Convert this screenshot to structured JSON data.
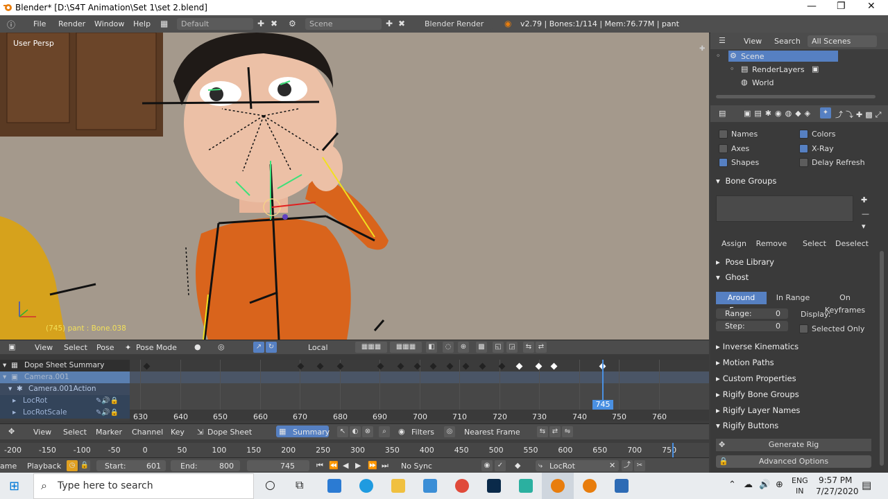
{
  "window": {
    "title": "Blender* [D:\\S4T Animation\\Set 1\\set 2.blend]",
    "min": "—",
    "restore": "❐",
    "close": "✕"
  },
  "info_header": {
    "menus": [
      "File",
      "Render",
      "Window",
      "Help"
    ],
    "screen_layout": "Default",
    "scene": "Scene",
    "engine": "Blender Render",
    "stats": "v2.79 | Bones:1/114 | Mem:76.77M | pant"
  },
  "viewport": {
    "view_label": "User Persp",
    "object_label": "(745) pant : Bone.038"
  },
  "viewport_header": {
    "menus": [
      "View",
      "Select",
      "Pose"
    ],
    "mode": "Pose Mode",
    "orientation": "Local"
  },
  "dopesheet": {
    "channels": [
      {
        "name": "Dope Sheet Summary",
        "level": 0
      },
      {
        "name": "Camera.001",
        "level": 0
      },
      {
        "name": "Camera.001Action",
        "level": 1
      },
      {
        "name": "LocRot",
        "level": 2
      },
      {
        "name": "LocRotScale",
        "level": 2
      }
    ],
    "frame_labels": [
      "630",
      "640",
      "650",
      "660",
      "670",
      "680",
      "690",
      "700",
      "710",
      "720",
      "730",
      "740",
      "750",
      "760"
    ],
    "current_frame": "745"
  },
  "dopesheet_header": {
    "menus": [
      "View",
      "Select",
      "Marker",
      "Channel",
      "Key"
    ],
    "mode": "Dope Sheet",
    "summary": "Summary",
    "filters": "Filters",
    "snap": "Nearest Frame"
  },
  "timeline": {
    "ruler_labels": [
      "-200",
      "-150",
      "-100",
      "-50",
      "0",
      "50",
      "100",
      "150",
      "200",
      "250",
      "300",
      "350",
      "400",
      "450",
      "500",
      "550",
      "600",
      "650",
      "700",
      "750"
    ],
    "left_cut": "ame",
    "playback": "Playback",
    "start_label": "Start:",
    "start": "601",
    "end_label": "End:",
    "end": "800",
    "current": "745",
    "sync": "No Sync",
    "keying_set": "LocRot"
  },
  "outliner": {
    "menus": [
      "View",
      "Search"
    ],
    "filter": "All Scenes",
    "items": [
      "Scene",
      "RenderLayers",
      "World"
    ]
  },
  "properties": {
    "display": {
      "names": "Names",
      "colors": "Colors",
      "axes": "Axes",
      "xray": "X-Ray",
      "shapes": "Shapes",
      "delay_refresh": "Delay Refresh"
    },
    "bone_groups": {
      "title": "Bone Groups",
      "buttons": [
        "Assign",
        "Remove",
        "Select",
        "Deselect"
      ]
    },
    "pose_library": "Pose Library",
    "ghost": {
      "title": "Ghost",
      "tabs": [
        "Around Frame",
        "In Range",
        "On Keyframes"
      ],
      "range_label": "Range:",
      "range": "0",
      "step_label": "Step:",
      "step": "0",
      "display_label": "Display:",
      "selected_only": "Selected Only"
    },
    "collapsed_panels": [
      "Inverse Kinematics",
      "Motion Paths",
      "Custom Properties",
      "Rigify Bone Groups",
      "Rigify Layer Names"
    ],
    "rigify_buttons": {
      "title": "Rigify Buttons",
      "generate": "Generate Rig",
      "advanced": "Advanced Options"
    }
  },
  "taskbar": {
    "search_placeholder": "Type here to search",
    "lang1": "ENG",
    "lang2": "IN",
    "time": "9:57 PM",
    "date": "7/27/2020"
  },
  "colors": {
    "accent": "#5680c2",
    "timeline_cursor": "#4a90e2",
    "viewport_bg": "#a09385"
  }
}
